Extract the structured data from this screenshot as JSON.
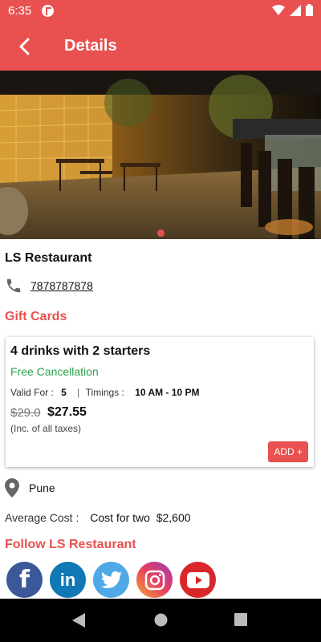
{
  "status_bar": {
    "time": "6:35"
  },
  "app_bar": {
    "title": "Details"
  },
  "restaurant": {
    "name": "LS Restaurant",
    "phone": "7878787878",
    "location": "Pune"
  },
  "gift_cards": {
    "section_title": "Gift Cards",
    "card": {
      "title": "4 drinks with 2 starters",
      "cancellation": "Free Cancellation",
      "valid_label": "Valid For :",
      "valid_value": "5",
      "separator": "|",
      "timings_label": "Timings :",
      "timings_value": "10 AM - 10 PM",
      "old_price": "$29.0",
      "new_price": "$27.55",
      "tax_note": "(Inc. of all taxes)",
      "add_label": "ADD +"
    }
  },
  "average_cost": {
    "label": "Average Cost :",
    "value": "Cost for two  $2,600"
  },
  "follow": {
    "title": "Follow LS Restaurant",
    "icons": [
      "facebook-icon",
      "linkedin-icon",
      "twitter-icon",
      "instagram-icon",
      "youtube-icon"
    ]
  },
  "colors": {
    "accent": "#e8514f",
    "green": "#2ba24c"
  }
}
